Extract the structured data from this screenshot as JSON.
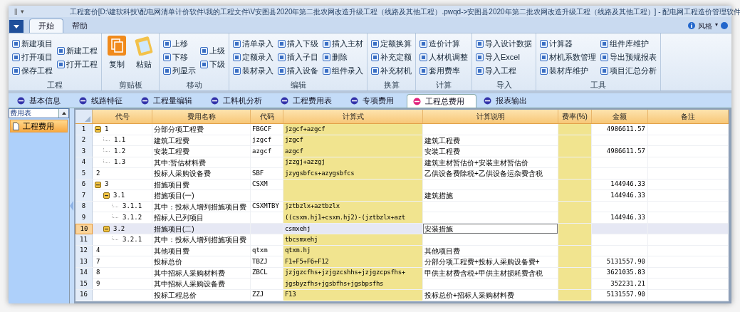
{
  "window": {
    "title": "工程套价[D:\\建软科技\\配电网清单计价软件\\我的工程文件\\V安图县2020年第二批农网改造升级工程（线路及其他工程）.pwqd->安图县2020年第二批农网改造升级工程（线路及其他工程）] - 配电网工程造价管理软件",
    "quick_access": [
      "||",
      "▾"
    ]
  },
  "menu_tabs": [
    {
      "label": "开始",
      "selected": true
    },
    {
      "label": "帮助",
      "selected": false
    }
  ],
  "style_menu": {
    "label": "风格",
    "caret": "▾"
  },
  "ribbon": [
    {
      "label": "工程",
      "columns": [
        [
          "新建项目",
          "打开项目",
          "保存工程"
        ],
        [
          "新建工程",
          "打开工程"
        ]
      ]
    },
    {
      "label": "剪贴板",
      "large": [
        "复制",
        "粘贴"
      ]
    },
    {
      "label": "移动",
      "columns": [
        [
          "上移",
          "下移",
          "列显示"
        ],
        [
          "上级",
          "下级"
        ]
      ]
    },
    {
      "label": "编辑",
      "columns": [
        [
          "清单录入",
          "定额录入",
          "装材录入"
        ],
        [
          "插入下级",
          "插入子目",
          "插入设备"
        ],
        [
          "插入主材",
          "删除",
          "组件录入"
        ]
      ]
    },
    {
      "label": "换算",
      "columns": [
        [
          "定额换算",
          "补充定额",
          "补充材机"
        ]
      ]
    },
    {
      "label": "计算",
      "columns": [
        [
          "造价计算",
          "人材机调整",
          "套用费率"
        ]
      ]
    },
    {
      "label": "导入",
      "columns": [
        [
          "导入设计数据",
          "导入Excel",
          "导入工程"
        ]
      ]
    },
    {
      "label": "工具",
      "columns": [
        [
          "计算器",
          "材机系数管理",
          "装材库维护"
        ],
        [
          "组件库维护",
          "导出预规报表",
          "项目汇总分析"
        ]
      ]
    }
  ],
  "tabs": [
    {
      "label": "基本信息",
      "selected": false
    },
    {
      "label": "线路特征",
      "selected": false
    },
    {
      "label": "工程量编辑",
      "selected": false
    },
    {
      "label": "工料机分析",
      "selected": false
    },
    {
      "label": "工程费用表",
      "selected": false
    },
    {
      "label": "专项费用",
      "selected": false
    },
    {
      "label": "工程总费用",
      "selected": true
    },
    {
      "label": "报表输出",
      "selected": false
    }
  ],
  "sidebar": {
    "title": "费用表",
    "items": [
      {
        "label": "工程费用",
        "selected": true
      }
    ]
  },
  "table": {
    "columns": [
      "代号",
      "费用名称",
      "代码",
      "计算式",
      "计算说明",
      "费率(%)",
      "金额",
      "备注"
    ],
    "rows": [
      {
        "row_no": "1",
        "code_no": "1",
        "name": "分部分项工程费",
        "code": "FBGCF",
        "formula": "jzgcf+azgcf",
        "amount": "4986611.57",
        "selected": false,
        "expanded": true,
        "children": [
          {
            "row_no": "2",
            "code_no": "1.1",
            "name": "建筑工程费",
            "code": "jzgcf",
            "formula": "jzgcf",
            "description": "建筑工程费",
            "selected": false
          },
          {
            "row_no": "3",
            "code_no": "1.2",
            "name": "安装工程费",
            "code": "azgcf",
            "formula": "azgcf",
            "description": "安装工程费",
            "amount": "4986611.57",
            "selected": false
          },
          {
            "row_no": "4",
            "code_no": "1.3",
            "name": "其中:暂估材料费",
            "formula": "jzzgj+azzgj",
            "description": "建筑主材暂估价+安装主材暂估价",
            "selected": false
          }
        ]
      },
      {
        "row_no": "5",
        "code_no": "2",
        "name": "投标人采购设备费",
        "code": "SBF",
        "formula": "jzygsbfcs+azygsbfcs",
        "description": "乙供设备费除税+乙供设备运杂费含税",
        "selected": false
      },
      {
        "row_no": "6",
        "code_no": "3",
        "name": "措施项目费",
        "code": "CSXM",
        "amount": "144946.33",
        "selected": false,
        "expanded": true,
        "children": [
          {
            "row_no": "7",
            "code_no": "3.1",
            "name": "措施项目(一)",
            "description": "建筑措施",
            "amount": "144946.33",
            "selected": false,
            "expanded": true,
            "children": [
              {
                "row_no": "8",
                "code_no": "3.1.1",
                "name": "其中：投标人增列措施项目费",
                "code": "CSXMTBY",
                "formula": "jztbzlx+aztbzlx",
                "selected": false
              },
              {
                "row_no": "9",
                "code_no": "3.1.2",
                "name": "招标人已列项目",
                "formula": "((csxm.hj1+csxm.hj2)-(jztbzlx+azt",
                "amount": "144946.33",
                "selected": false
              }
            ]
          },
          {
            "row_no": "10",
            "code_no": "3.2",
            "name": "措施项目(二)",
            "formula": "csmxehj",
            "description": "安装措施",
            "selected": true,
            "expanded": true,
            "children": [
              {
                "row_no": "11",
                "code_no": "3.2.1",
                "name": "其中：投标人增列措施项目费",
                "formula": "tbcsmxehj",
                "selected": false
              }
            ]
          }
        ]
      },
      {
        "row_no": "12",
        "code_no": "4",
        "name": "其他项目费",
        "code": "qtxm",
        "formula": "qtxm.hj",
        "description": "其他项目费",
        "selected": false
      },
      {
        "row_no": "13",
        "code_no": "7",
        "name": "投标总价",
        "code": "TBZJ",
        "formula": "F1+F5+F6+F12",
        "description": "分部分项工程费+投标人采购设备费+",
        "amount": "5131557.90",
        "selected": false
      },
      {
        "row_no": "14",
        "code_no": "8",
        "name": "其中招标人采购材料费",
        "code": "ZBCL",
        "formula": "jzjgzcfhs+jzjgzcshhs+jzjgzcpsfhs+",
        "description": "甲供主材费含税+甲供主材损耗费含税",
        "amount": "3621035.83",
        "selected": false
      },
      {
        "row_no": "15",
        "code_no": "9",
        "name": "其中招标人采购设备费",
        "formula": "jgsbyzfhs+jgsbfhs+jgsbpsfhs",
        "amount": "352231.21",
        "selected": false
      },
      {
        "row_no": "16",
        "name": "投标工程总价",
        "code": "ZZJ",
        "formula": "F13",
        "description": "投标总价+招标人采购材料费",
        "amount": "5131557.90",
        "selected": false
      }
    ]
  }
}
